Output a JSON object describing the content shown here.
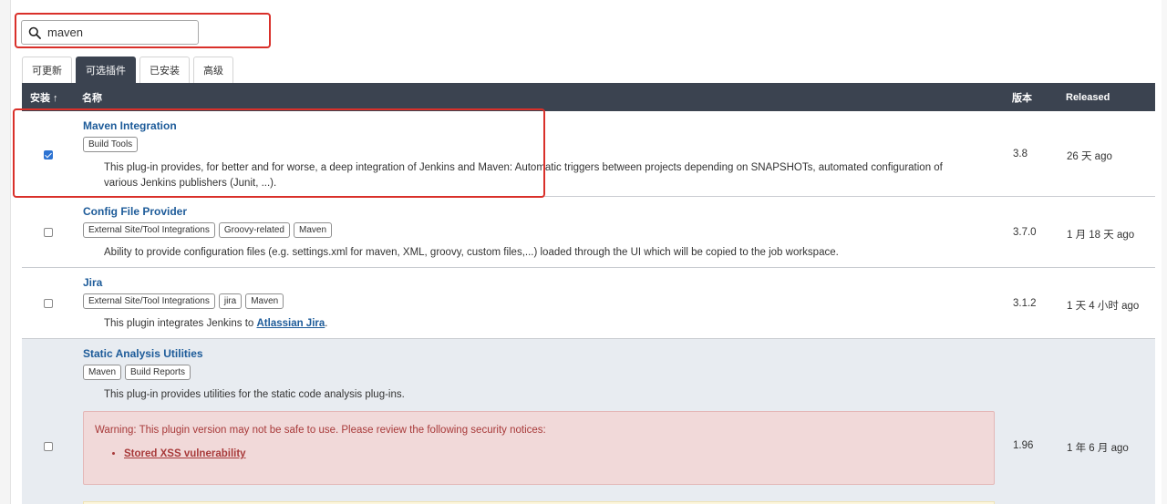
{
  "search": {
    "value": "maven",
    "placeholder": ""
  },
  "tabs": [
    {
      "label": "可更新",
      "active": false
    },
    {
      "label": "可选插件",
      "active": true
    },
    {
      "label": "已安装",
      "active": false
    },
    {
      "label": "高级",
      "active": false
    }
  ],
  "table": {
    "headers": {
      "install": "安装 ↑",
      "name": "名称",
      "version": "版本",
      "released": "Released"
    },
    "rows": [
      {
        "name": "Maven Integration",
        "checked": true,
        "tags": [
          "Build Tools"
        ],
        "description": "This plug-in provides, for better and for worse, a deep integration of Jenkins and Maven: Automatic triggers between projects depending on SNAPSHOTs, automated configuration of",
        "description_line2": "various Jenkins publishers (Junit, ...).",
        "version": "3.8",
        "released": "26 天 ago"
      },
      {
        "name": "Config File Provider",
        "checked": false,
        "tags": [
          "External Site/Tool Integrations",
          "Groovy-related",
          "Maven"
        ],
        "description": "Ability to provide configuration files (e.g. settings.xml for maven, XML, groovy, custom files,...) loaded through the UI which will be copied to the job workspace.",
        "version": "3.7.0",
        "released": "1 月 18 天 ago"
      },
      {
        "name": "Jira",
        "checked": false,
        "tags": [
          "External Site/Tool Integrations",
          "jira",
          "Maven"
        ],
        "description_prefix": "This plugin integrates Jenkins to ",
        "description_link": "Atlassian Jira",
        "description_suffix": ".",
        "version": "3.1.2",
        "released": "1 天 4 小时 ago"
      },
      {
        "name": "Static Analysis Utilities",
        "checked": false,
        "tags": [
          "Maven",
          "Build Reports"
        ],
        "description": "This plug-in provides utilities for the static code analysis plug-ins.",
        "warning_text": "Warning: This plugin version may not be safe to use. Please review the following security notices:",
        "warning_link": "Stored XSS vulnerability",
        "version": "1.96",
        "released": "1 年 6 月 ago"
      }
    ]
  },
  "colors": {
    "header_bg": "#3b4350",
    "link": "#1d5b99",
    "highlight": "#d9302a",
    "warning_bg": "#f1d9d9"
  }
}
